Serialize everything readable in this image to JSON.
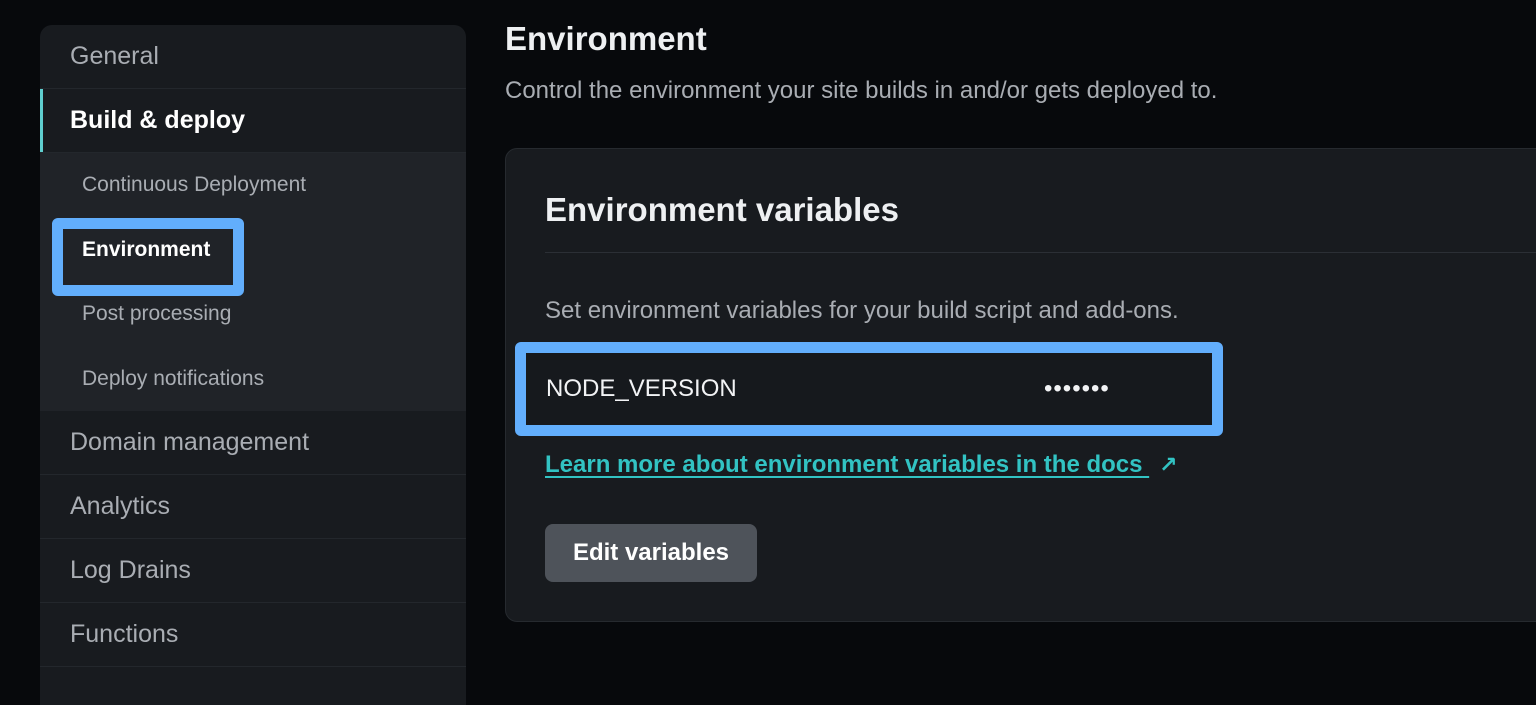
{
  "sidebar": {
    "items": [
      {
        "label": "General"
      },
      {
        "label": "Build & deploy",
        "active": true
      },
      {
        "label": "Domain management"
      },
      {
        "label": "Analytics"
      },
      {
        "label": "Log Drains"
      },
      {
        "label": "Functions"
      }
    ],
    "subitems": [
      {
        "label": "Continuous Deployment"
      },
      {
        "label": "Environment",
        "current": true
      },
      {
        "label": "Post processing"
      },
      {
        "label": "Deploy notifications"
      }
    ]
  },
  "main": {
    "title": "Environment",
    "subtitle": "Control the environment your site builds in and/or gets deployed to.",
    "card": {
      "title": "Environment variables",
      "description": "Set environment variables for your build script and add-ons.",
      "variables": [
        {
          "key": "NODE_VERSION",
          "value": "•••••••"
        }
      ],
      "docs_link": "Learn more about environment variables in the docs",
      "docs_icon": "↗",
      "edit_button": "Edit variables"
    }
  },
  "colors": {
    "accent_teal": "#32c3c3",
    "highlight_blue": "#62aefc",
    "background": "#07090c",
    "panel": "#181b1f"
  }
}
